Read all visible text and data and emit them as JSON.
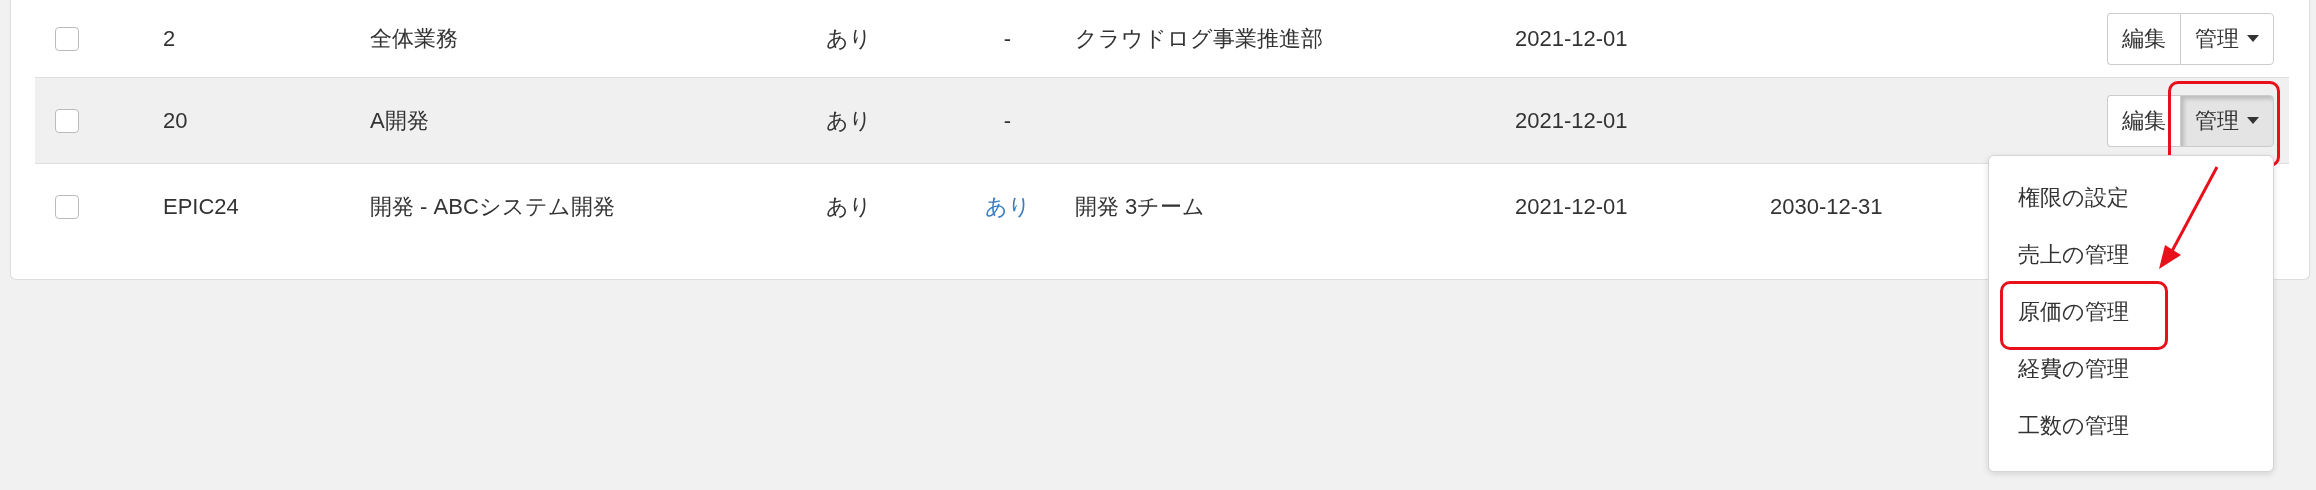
{
  "rows": [
    {
      "checked": false,
      "hovered": false,
      "code": "2",
      "name": "全体業務",
      "column_4": "あり",
      "column_5": {
        "text": "-",
        "link": false
      },
      "department": "クラウドログ事業推進部",
      "start": "2021-12-01",
      "end": "",
      "actions": {
        "edit": "編集",
        "manage": "管理",
        "open": false,
        "highlighted": false
      }
    },
    {
      "checked": false,
      "hovered": true,
      "code": "20",
      "name": "A開発",
      "column_4": "あり",
      "column_5": {
        "text": "-",
        "link": false
      },
      "department": "",
      "start": "2021-12-01",
      "end": "",
      "actions": {
        "edit": "編集",
        "manage": "管理",
        "open": true,
        "highlighted": true,
        "menu": [
          {
            "label": "権限の設定",
            "highlighted": false
          },
          {
            "label": "売上の管理",
            "highlighted": false
          },
          {
            "label": "原価の管理",
            "highlighted": true
          },
          {
            "label": "経費の管理",
            "highlighted": false
          },
          {
            "label": "工数の管理",
            "highlighted": false
          }
        ]
      }
    },
    {
      "checked": false,
      "hovered": false,
      "code": "EPIC24",
      "name": "開発 - ABCシステム開発",
      "column_4": "あり",
      "column_5": {
        "text": "あり",
        "link": true
      },
      "department": "開発 3チーム",
      "start": "2021-12-01",
      "end": "2030-12-31"
    }
  ]
}
